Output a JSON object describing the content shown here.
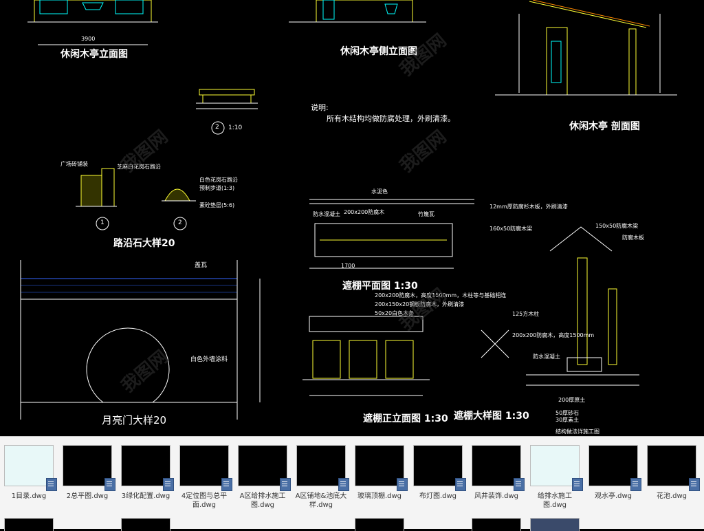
{
  "drawing": {
    "titles": {
      "pavilion_front": "休闲木亭立面图",
      "pavilion_side": "休闲木亭侧立面图",
      "pavilion_section": "休闲木亭    剖面图",
      "curb": "路沿石大样20",
      "moongate": "月亮门大样20",
      "shed_plan": "遮棚平面图 1:30",
      "shed_front": "遮棚正立面图 1:30",
      "shed_detail": "遮棚大样图 1:30"
    },
    "notes": {
      "heading": "说明:",
      "body": "所有木结构均做防腐处理，外刷清漆。"
    },
    "labels": {
      "detail2_scale": "1:10",
      "circle1": "1",
      "circle2": "2",
      "curb_a": "广场砖铺装",
      "curb_b": "芝麻白花岗石路沿",
      "curb_c": "白色花岗石路沿",
      "curb_d": "预制步道(1:3)",
      "curb_e": "素砼垫层(5:6)",
      "gaiwa": "盖瓦",
      "wall_paint": "白色外墙涂料",
      "shed_top": "水泥色",
      "shed_beam": "200x200防腐木",
      "shed_mid": "竹篾瓦",
      "shed_wood": "防水混凝土",
      "front_n1": "200x200防腐木，高度1500mm，木柱等与基础相连",
      "front_n2": "200x150x20钢板防腐木，外刷清漆",
      "front_n3": "50x20白色木条",
      "detail_n1": "12mm厚防腐杉木板，外刷清漆",
      "detail_n2": "160x50防腐木梁",
      "detail_n3": "150x50防腐木梁",
      "detail_n4": "防腐木板",
      "detail_n5": "125方木柱",
      "detail_n6": "200x200防腐木，高度1500mm",
      "detail_n7": "防水混凝土",
      "detail_n8": "200厚原土",
      "detail_n9": "50厚砂石",
      "detail_n10": "30厚素土",
      "detail_n11": "结构做法详施工图",
      "dim_3900": "3900",
      "dim_1700": "1700"
    }
  },
  "files": [
    {
      "name": "1目录.dwg",
      "light": true
    },
    {
      "name": "2总平图.dwg",
      "light": false
    },
    {
      "name": "3绿化配置.dwg",
      "light": false
    },
    {
      "name": "4定位图与总平面.dwg",
      "light": false
    },
    {
      "name": "A区给排水施工图.dwg",
      "light": false
    },
    {
      "name": "A区铺地&池底大样.dwg",
      "light": false
    },
    {
      "name": "玻璃顶棚.dwg",
      "light": false
    },
    {
      "name": "布灯图.dwg",
      "light": false
    },
    {
      "name": "风井装饰.dwg",
      "light": false
    },
    {
      "name": "给排水施工图.dwg",
      "light": true
    },
    {
      "name": "观水亭.dwg",
      "light": false
    },
    {
      "name": "花池.dwg",
      "light": false
    }
  ],
  "watermark": "我图网",
  "colors": {
    "canvas_bg": "#000000",
    "line_yellow": "#ffff33",
    "line_cyan": "#00ffff",
    "line_white": "#ffffff",
    "line_green": "#00ff00",
    "line_blue": "#3366ff",
    "line_magenta": "#ff33ff"
  }
}
